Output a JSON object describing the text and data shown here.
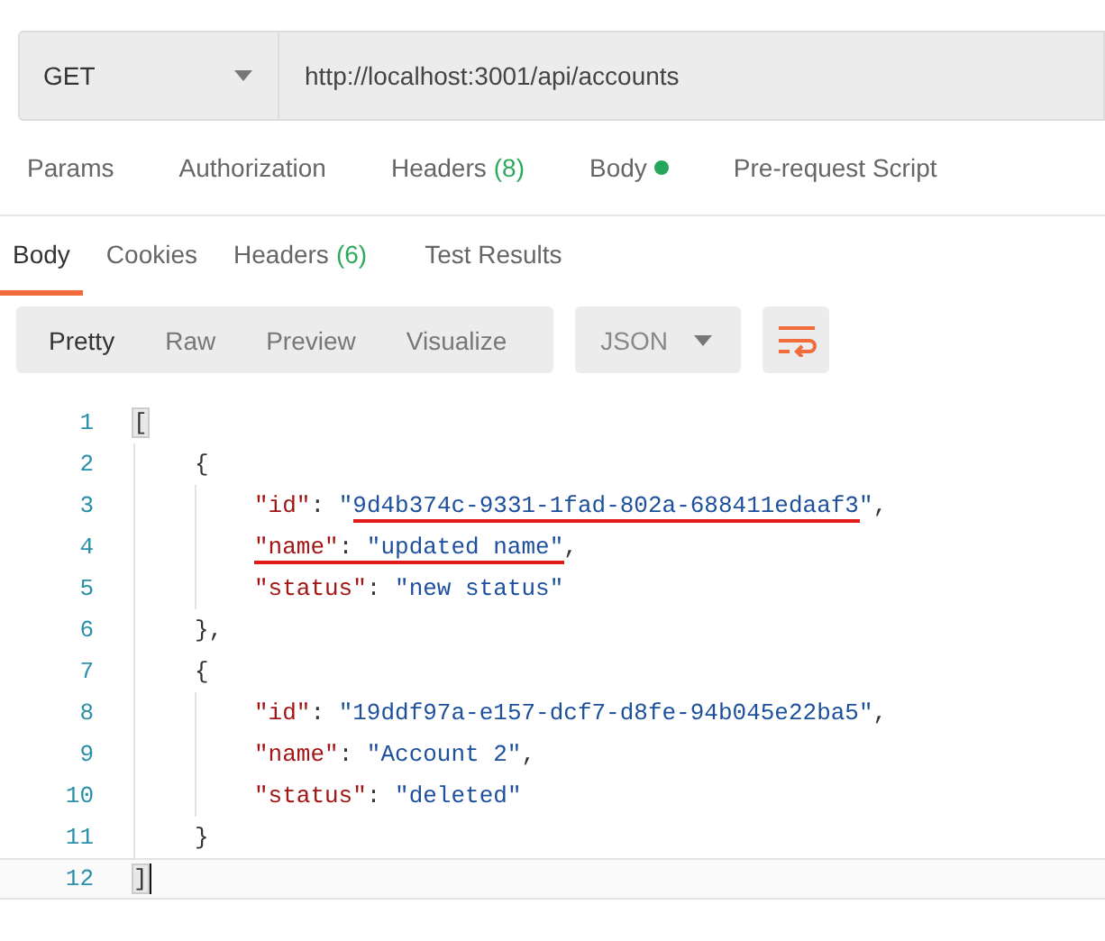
{
  "request": {
    "method": "GET",
    "url": "http://localhost:3001/api/accounts"
  },
  "request_tabs": [
    {
      "label": "Params",
      "dot": false
    },
    {
      "label": "Authorization",
      "dot": false
    },
    {
      "label": "Headers",
      "count": "(8)",
      "dot": false
    },
    {
      "label": "Body",
      "dot": true
    },
    {
      "label": "Pre-request Script",
      "dot": false
    }
  ],
  "response_tabs": [
    {
      "label": "Body",
      "selected": true
    },
    {
      "label": "Cookies",
      "selected": false
    },
    {
      "label": "Headers",
      "count": "(6)",
      "selected": false
    },
    {
      "label": "Test Results",
      "selected": false
    }
  ],
  "view_modes": [
    {
      "label": "Pretty",
      "selected": true
    },
    {
      "label": "Raw",
      "selected": false
    },
    {
      "label": "Preview",
      "selected": false
    },
    {
      "label": "Visualize",
      "selected": false
    }
  ],
  "format": "JSON",
  "code_lines": [
    {
      "number": "1",
      "current": false,
      "tokens": [
        {
          "kind": "bracket",
          "text": "["
        }
      ],
      "children": [
        {
          "number": "2",
          "current": false,
          "tokens": [
            {
              "kind": "punct",
              "text": "{"
            }
          ],
          "children": [
            {
              "number": "3",
              "current": false,
              "tokens": [
                {
                  "kind": "key",
                  "text": "\"id\""
                },
                {
                  "kind": "punct",
                  "text": ": "
                },
                {
                  "kind": "string",
                  "text": "\""
                },
                {
                  "kind": "mark",
                  "tokens": [
                    {
                      "kind": "string",
                      "text": "9d4b374c-9331-1fad-802a-688411edaaf3"
                    }
                  ]
                },
                {
                  "kind": "string",
                  "text": "\""
                },
                {
                  "kind": "punct",
                  "text": ","
                }
              ]
            },
            {
              "number": "4",
              "current": false,
              "tokens": [
                {
                  "kind": "mark",
                  "tokens": [
                    {
                      "kind": "key",
                      "text": "\"name\""
                    },
                    {
                      "kind": "punct",
                      "text": ": "
                    },
                    {
                      "kind": "string",
                      "text": "\"updated name\""
                    }
                  ]
                },
                {
                  "kind": "punct",
                  "text": ","
                }
              ]
            },
            {
              "number": "5",
              "current": false,
              "tokens": [
                {
                  "kind": "key",
                  "text": "\"status\""
                },
                {
                  "kind": "punct",
                  "text": ": "
                },
                {
                  "kind": "string",
                  "text": "\"new status\""
                }
              ]
            }
          ]
        },
        {
          "number": "6",
          "current": false,
          "tokens": [
            {
              "kind": "punct",
              "text": "},"
            }
          ]
        },
        {
          "number": "7",
          "current": false,
          "tokens": [
            {
              "kind": "punct",
              "text": "{"
            }
          ],
          "children": [
            {
              "number": "8",
              "current": false,
              "tokens": [
                {
                  "kind": "key",
                  "text": "\"id\""
                },
                {
                  "kind": "punct",
                  "text": ": "
                },
                {
                  "kind": "string",
                  "text": "\"19ddf97a-e157-dcf7-d8fe-94b045e22ba5\""
                },
                {
                  "kind": "punct",
                  "text": ","
                }
              ]
            },
            {
              "number": "9",
              "current": false,
              "tokens": [
                {
                  "kind": "key",
                  "text": "\"name\""
                },
                {
                  "kind": "punct",
                  "text": ": "
                },
                {
                  "kind": "string",
                  "text": "\"Account 2\""
                },
                {
                  "kind": "punct",
                  "text": ","
                }
              ]
            },
            {
              "number": "10",
              "current": false,
              "tokens": [
                {
                  "kind": "key",
                  "text": "\"status\""
                },
                {
                  "kind": "punct",
                  "text": ": "
                },
                {
                  "kind": "string",
                  "text": "\"deleted\""
                }
              ]
            }
          ]
        },
        {
          "number": "11",
          "current": false,
          "tokens": [
            {
              "kind": "punct",
              "text": "}"
            }
          ]
        }
      ]
    },
    {
      "number": "12",
      "current": true,
      "tokens": [
        {
          "kind": "bracket",
          "text": "]"
        }
      ]
    }
  ]
}
